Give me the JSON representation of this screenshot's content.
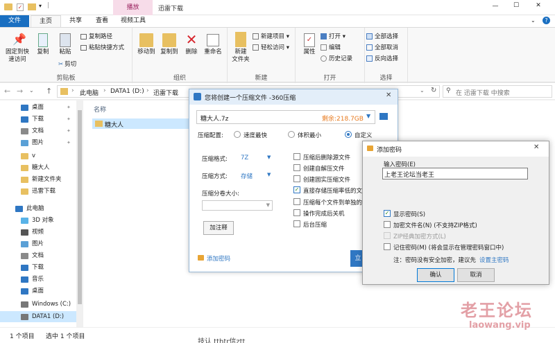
{
  "window": {
    "title": "迅雷下载",
    "context_tab": "播放",
    "minimize": "—",
    "maximize": "☐",
    "close": "✕"
  },
  "tabs": [
    {
      "label": "文件"
    },
    {
      "label": "主页"
    },
    {
      "label": "共享"
    },
    {
      "label": "查看"
    },
    {
      "label": "视频工具"
    }
  ],
  "ribbon": {
    "clipboard": {
      "label": "剪贴板",
      "pin": "固定到快\n速访问",
      "copy": "复制",
      "paste": "粘贴",
      "copy_path": "复制路径",
      "paste_shortcut": "粘贴快捷方式",
      "cut": "剪切"
    },
    "organize": {
      "label": "组织",
      "move_to": "移动到",
      "copy_to": "复制到",
      "delete": "删除",
      "rename": "重命名"
    },
    "new": {
      "label": "新建",
      "new_folder": "新建\n文件夹",
      "new_item": "新建项目",
      "easy_access": "轻松访问"
    },
    "open": {
      "label": "打开",
      "properties": "属性",
      "open": "打开",
      "edit": "编辑",
      "history": "历史记录"
    },
    "select": {
      "label": "选择",
      "select_all": "全部选择",
      "select_none": "全部取消",
      "invert": "反向选择"
    }
  },
  "address": {
    "path": [
      "此电脑",
      "DATA1 (D:)",
      "迅雷下载"
    ],
    "search_placeholder": "在 迅雷下载 中搜索"
  },
  "nav": {
    "items": [
      {
        "label": "桌面",
        "icon": "desktop-icon"
      },
      {
        "label": "下载",
        "icon": "download-icon"
      },
      {
        "label": "文档",
        "icon": "document-icon"
      },
      {
        "label": "图片",
        "icon": "picture-icon"
      },
      {
        "label": "v",
        "icon": "folder-icon"
      },
      {
        "label": "糖大人",
        "icon": "folder-icon"
      },
      {
        "label": "新建文件夹",
        "icon": "folder-icon"
      },
      {
        "label": "迅雷下载",
        "icon": "folder-icon"
      },
      {
        "label": "此电脑",
        "icon": "pc-icon"
      },
      {
        "label": "3D 对象",
        "icon": "3d-icon"
      },
      {
        "label": "视频",
        "icon": "video-icon"
      },
      {
        "label": "图片",
        "icon": "picture-icon"
      },
      {
        "label": "文档",
        "icon": "document-icon"
      },
      {
        "label": "下载",
        "icon": "download-icon"
      },
      {
        "label": "音乐",
        "icon": "music-icon"
      },
      {
        "label": "桌面",
        "icon": "desktop-icon"
      },
      {
        "label": "Windows (C:)",
        "icon": "drive-icon"
      },
      {
        "label": "DATA1 (D:)",
        "icon": "drive-icon"
      }
    ]
  },
  "list": {
    "column_name": "名称",
    "rows": [
      {
        "name": "糖大人"
      }
    ]
  },
  "status": {
    "count": "1 个项目",
    "selected": "选中 1 个项目"
  },
  "dlg360": {
    "title": "您将创建一个压缩文件 -360压缩",
    "filename": "糖大人.7z",
    "free": "剩余:218.7GB",
    "config_label": "压缩配置:",
    "opt_fast": "速度最快",
    "opt_small": "体积最小",
    "opt_custom": "自定义",
    "format_label": "压缩格式:",
    "format_value": "7Z",
    "method_label": "压缩方式:",
    "method_value": "存储",
    "split_label": "压缩分卷大小:",
    "comment_btn": "加注释",
    "checks": [
      {
        "label": "压缩后删除源文件",
        "checked": false
      },
      {
        "label": "创建自解压文件",
        "checked": false
      },
      {
        "label": "创建固实压缩文件",
        "checked": false
      },
      {
        "label": "直接存储压缩率低的文",
        "checked": true
      },
      {
        "label": "压缩每个文件到单独的",
        "checked": false
      },
      {
        "label": "操作完成后关机",
        "checked": false
      },
      {
        "label": "后台压缩",
        "checked": false
      }
    ],
    "add_password": "添加密码",
    "start_btn": "立"
  },
  "dlgpw": {
    "title": "添加密码",
    "input_label": "输入密码(E)",
    "input_value": "上老王论坛当老王",
    "show_pw": "显示密码(S)",
    "encrypt_names": "加密文件名(N) (不支持ZIP格式)",
    "zip_classic": "ZIP经典加密方式(L)",
    "remember": "记住密码(M) (将会显示在管理密码窗口中)",
    "note": "注：密码没有安全加密，建议先",
    "note_link": "设置主密码",
    "ok": "确认",
    "cancel": "取消"
  },
  "watermark": {
    "cn": "老王论坛",
    "en": "laowang.vip"
  },
  "bg_text": "技认 tthtr信ztt"
}
